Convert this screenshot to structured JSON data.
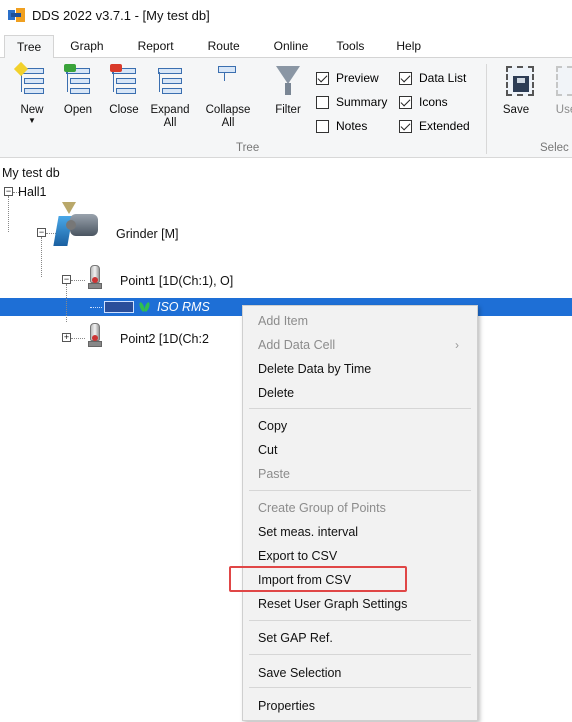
{
  "window": {
    "title": "DDS 2022 v3.7.1 - [My test db]"
  },
  "menu_tabs": [
    {
      "label": "Tree"
    },
    {
      "label": "Graph"
    },
    {
      "label": "Report"
    },
    {
      "label": "Route"
    },
    {
      "label": "Online"
    },
    {
      "label": "Tools"
    },
    {
      "label": "Help"
    }
  ],
  "ribbon": {
    "buttons": {
      "new": "New",
      "open": "Open",
      "close": "Close",
      "expand_line1": "Expand",
      "expand_line2": "All",
      "collapse_line1": "Collapse",
      "collapse_line2": "All",
      "filter": "Filter",
      "save": "Save",
      "use_partial": "Use"
    },
    "checks": {
      "preview": {
        "label": "Preview",
        "checked": true
      },
      "summary": {
        "label": "Summary",
        "checked": false
      },
      "notes": {
        "label": "Notes",
        "checked": false
      },
      "data_list": {
        "label": "Data List",
        "checked": true
      },
      "icons": {
        "label": "Icons",
        "checked": true
      },
      "extended": {
        "label": "Extended",
        "checked": true
      }
    },
    "groups": {
      "tree": "Tree",
      "select_partial": "Selec"
    }
  },
  "tree": {
    "root": "My test db",
    "hall": "Hall1",
    "machine": "Grinder [M]",
    "point1": "Point1 [1D(Ch:1), O]",
    "channel": "ISO RMS",
    "point2": "Point2 [1D(Ch:2"
  },
  "context_menu": {
    "items": [
      {
        "label": "Add Item",
        "enabled": false
      },
      {
        "label": "Add Data Cell",
        "enabled": false,
        "submenu_glyph": "›"
      },
      {
        "label": "Delete Data by Time",
        "enabled": true
      },
      {
        "label": "Delete",
        "enabled": true
      },
      {
        "label": "Copy",
        "enabled": true
      },
      {
        "label": "Cut",
        "enabled": true
      },
      {
        "label": "Paste",
        "enabled": false
      },
      {
        "label": "Create Group of Points",
        "enabled": false
      },
      {
        "label": "Set meas. interval",
        "enabled": true
      },
      {
        "label": "Export to CSV",
        "enabled": true
      },
      {
        "label": "Import from CSV",
        "enabled": true,
        "highlighted": true
      },
      {
        "label": "Reset User Graph Settings",
        "enabled": true
      },
      {
        "label": "Set GAP Ref.",
        "enabled": true
      },
      {
        "label": "Save Selection",
        "enabled": true
      },
      {
        "label": "Properties",
        "enabled": true
      }
    ]
  },
  "colors": {
    "selection": "#1e6fd6",
    "highlight_border": "#e04646",
    "disabled_text": "#8c8c8c"
  },
  "icons": {
    "app": "dds-app-icon",
    "expander_minus": "⊟",
    "expander_plus": "⊞"
  }
}
